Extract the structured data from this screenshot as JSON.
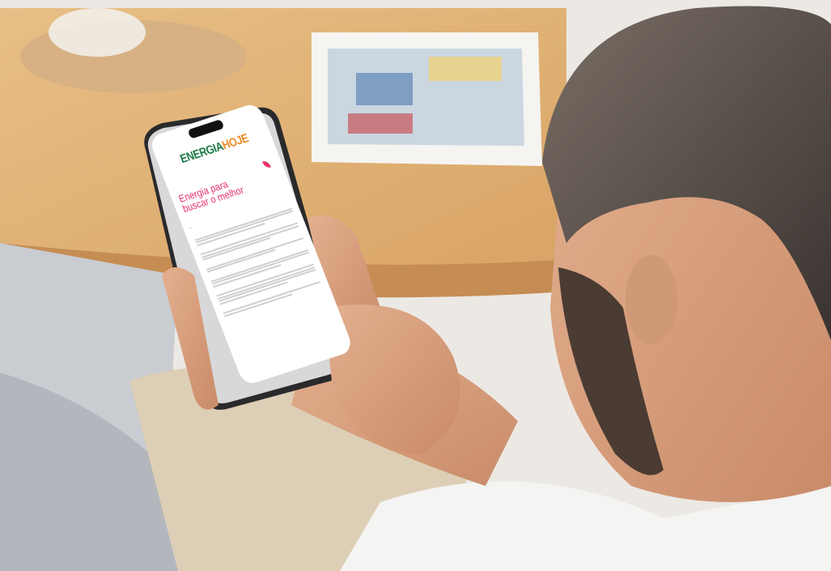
{
  "phone": {
    "logo_part1": "ENERGIA",
    "logo_part2": "HOJE",
    "hero_title": "Energia para buscar o melhor"
  },
  "colors": {
    "brand_green": "#1a7a47",
    "brand_orange": "#f08a24",
    "brand_pink": "#e6336a",
    "link_blue": "#1f57b8"
  }
}
